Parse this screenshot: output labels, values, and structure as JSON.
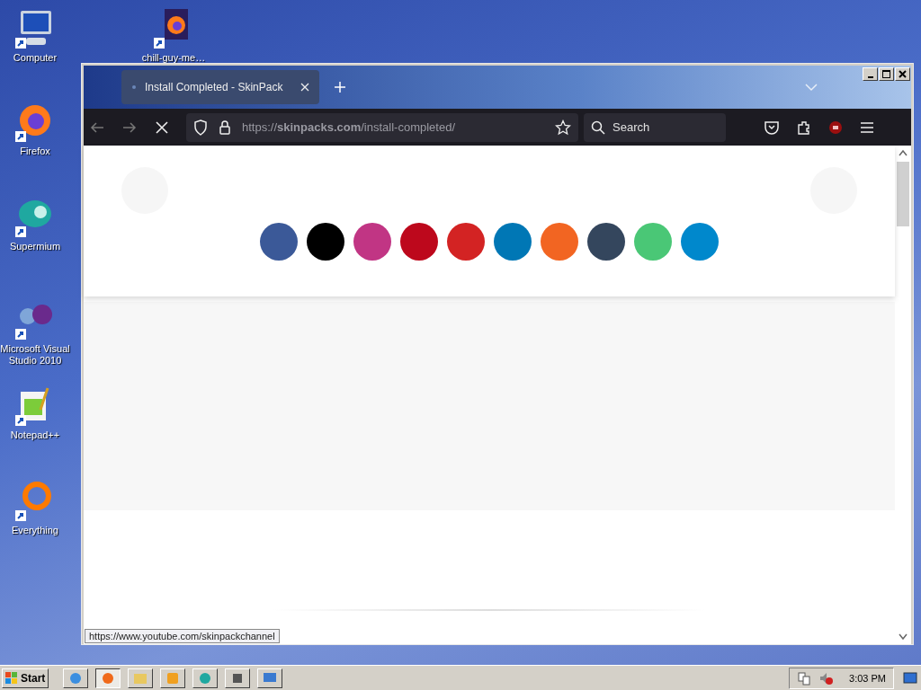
{
  "desktop_icons": [
    {
      "kind": "computer",
      "label": "Computer"
    },
    {
      "kind": "file",
      "label": "chill-guy-me…"
    },
    {
      "kind": "firefox",
      "label": "Firefox"
    },
    {
      "kind": "supermium",
      "label": "Supermium"
    },
    {
      "kind": "vs",
      "label": "Microsoft Visual Studio 2010"
    },
    {
      "kind": "notepad",
      "label": "Notepad++"
    },
    {
      "kind": "everything",
      "label": "Everything"
    }
  ],
  "browser": {
    "tabs": [
      {
        "title": "Install Completed - SkinPack",
        "selected": true
      }
    ],
    "url": "https://**skinpacks.com**/install-completed/",
    "search": {
      "placeholder": "Search"
    },
    "social_buttons": [
      {
        "color": "#3b5998"
      },
      {
        "color": "#000000"
      },
      {
        "color": "#c13584"
      },
      {
        "color": "#bd081c"
      },
      {
        "color": "#d32323"
      },
      {
        "color": "#0077b5"
      },
      {
        "color": "#f26522"
      },
      {
        "color": "#34465d"
      },
      {
        "color": "#4ac776"
      },
      {
        "color": "#0088cc"
      }
    ],
    "status_link": "https://www.youtube.com/skinpackchannel"
  },
  "taskbar": {
    "start": "Start",
    "apps": [
      {
        "kind": "ie",
        "selected": false
      },
      {
        "kind": "firefox",
        "selected": true
      },
      {
        "kind": "folder",
        "selected": false
      },
      {
        "kind": "media",
        "selected": false
      },
      {
        "kind": "supermium",
        "selected": false
      },
      {
        "kind": "windows",
        "selected": false
      },
      {
        "kind": "monitor",
        "selected": false
      }
    ],
    "clock": "3:03 PM"
  }
}
